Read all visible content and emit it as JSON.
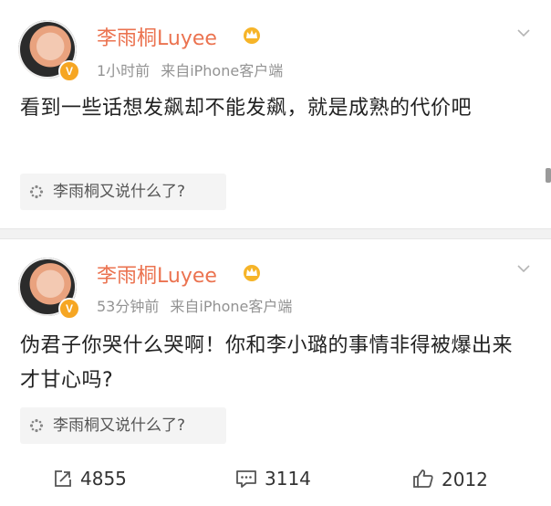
{
  "colors": {
    "name": "#eb7350",
    "meta": "#939393",
    "text": "#222222",
    "badge": "#f6a623"
  },
  "posts": [
    {
      "author": "李雨桐Luyee",
      "time": "1小时前",
      "source": "来自iPhone客户端",
      "text": "看到一些话想发飙却不能发飙，就是成熟的代价吧",
      "reply_prompt": "李雨桐又说什么了?"
    },
    {
      "author": "李雨桐Luyee",
      "time": "53分钟前",
      "source": "来自iPhone客户端",
      "text": "伪君子你哭什么哭啊！你和李小璐的事情非得被爆出来才甘心吗?",
      "reply_prompt": "李雨桐又说什么了?"
    }
  ],
  "verified_badge": "V",
  "actions": {
    "share_count": "4855",
    "comment_count": "3114",
    "like_count": "2012"
  }
}
